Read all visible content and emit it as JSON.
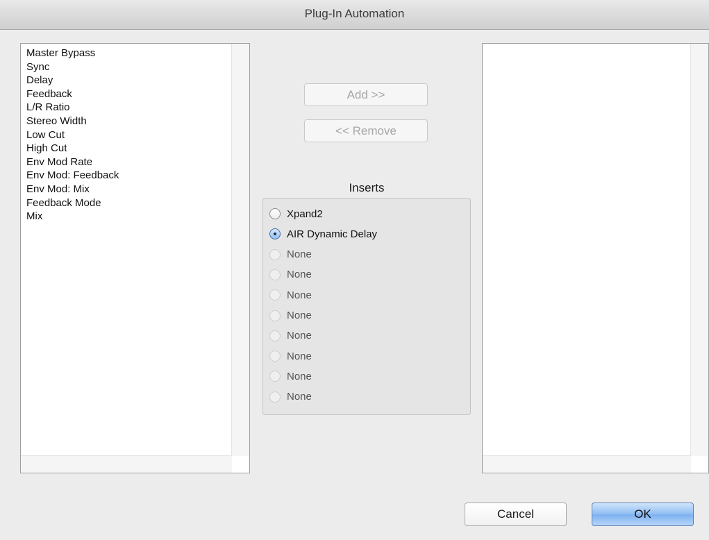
{
  "window": {
    "title": "Plug-In Automation"
  },
  "parameters": [
    "Master Bypass",
    "Sync",
    "Delay",
    "Feedback",
    "L/R Ratio",
    "Stereo Width",
    "Low Cut",
    "High Cut",
    "Env Mod Rate",
    "Env Mod: Feedback",
    "Env Mod: Mix",
    "Feedback Mode",
    "Mix"
  ],
  "automated": [],
  "buttons": {
    "add": "Add >>",
    "remove": "<< Remove",
    "cancel": "Cancel",
    "ok": "OK"
  },
  "inserts": {
    "label": "Inserts",
    "options": [
      {
        "label": "Xpand2",
        "selected": false,
        "enabled": true
      },
      {
        "label": "AIR Dynamic Delay",
        "selected": true,
        "enabled": true
      },
      {
        "label": "None",
        "selected": false,
        "enabled": false
      },
      {
        "label": "None",
        "selected": false,
        "enabled": false
      },
      {
        "label": "None",
        "selected": false,
        "enabled": false
      },
      {
        "label": "None",
        "selected": false,
        "enabled": false
      },
      {
        "label": "None",
        "selected": false,
        "enabled": false
      },
      {
        "label": "None",
        "selected": false,
        "enabled": false
      },
      {
        "label": "None",
        "selected": false,
        "enabled": false
      },
      {
        "label": "None",
        "selected": false,
        "enabled": false
      }
    ]
  },
  "colors": {
    "window_bg": "#ececec",
    "default_button": "#8fbdf2",
    "selected_radio": "#4a6fa5"
  }
}
